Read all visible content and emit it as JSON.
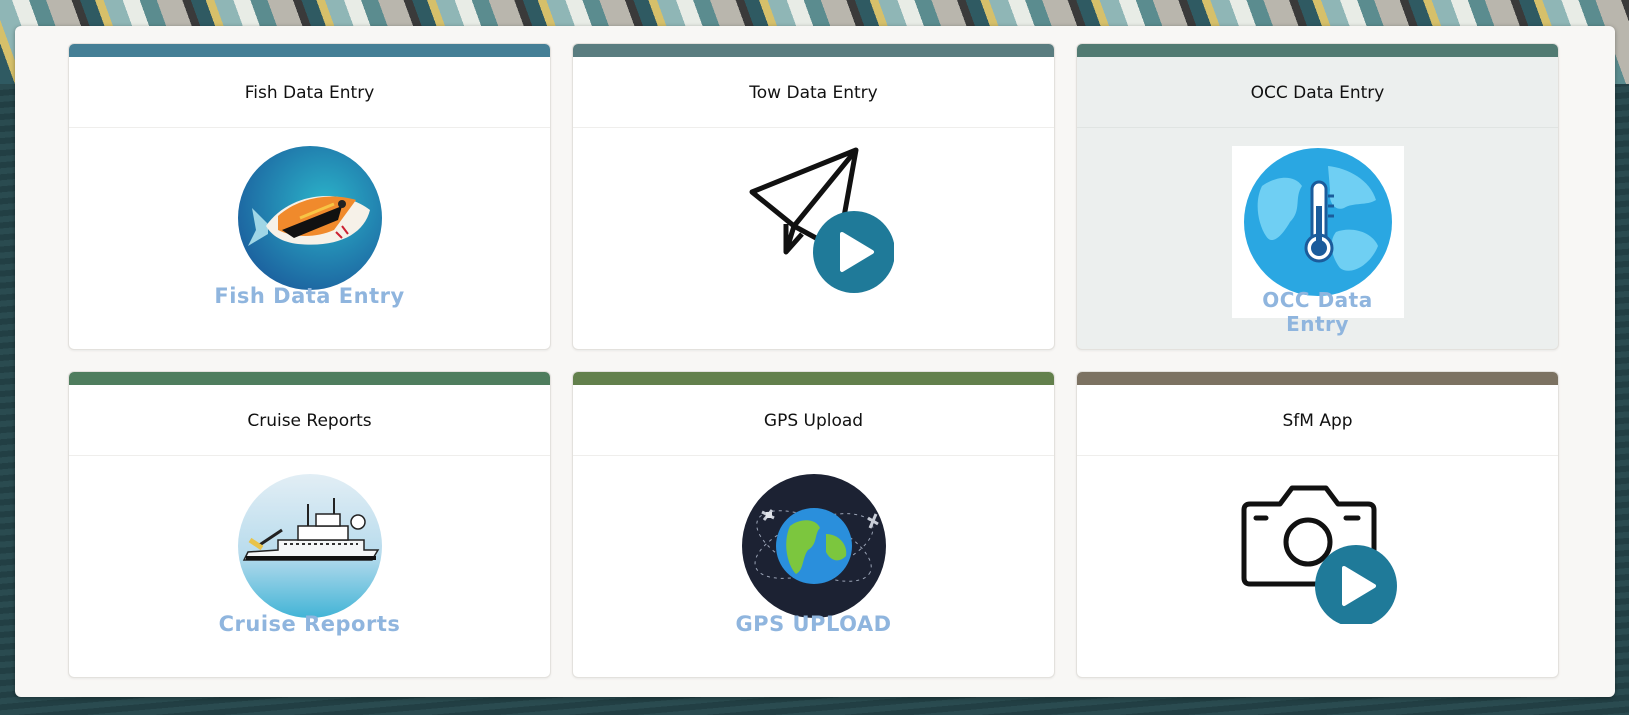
{
  "cards": [
    {
      "title": "Fish Data Entry",
      "bar_color": "#457f96",
      "icon": "triggerfish-icon",
      "caption": "Fish Data Entry"
    },
    {
      "title": "Tow Data Entry",
      "bar_color": "#5a7d80",
      "icon": "paper-plane-play-icon",
      "caption": ""
    },
    {
      "title": "OCC Data Entry",
      "bar_color": "#517a72",
      "icon": "globe-thermometer-icon",
      "caption": "OCC Data Entry"
    },
    {
      "title": "Cruise Reports",
      "bar_color": "#4f7d5e",
      "icon": "research-ship-icon",
      "caption": "Cruise Reports"
    },
    {
      "title": "GPS Upload",
      "bar_color": "#63804c",
      "icon": "earth-satellites-icon",
      "caption": "GPS UPLOAD"
    },
    {
      "title": "SfM App",
      "bar_color": "#7c7262",
      "icon": "camera-play-icon",
      "caption": ""
    }
  ],
  "colors": {
    "play_button": "#1f7a99",
    "caption": "#8fb5de",
    "panel": "#f8f7f5"
  }
}
